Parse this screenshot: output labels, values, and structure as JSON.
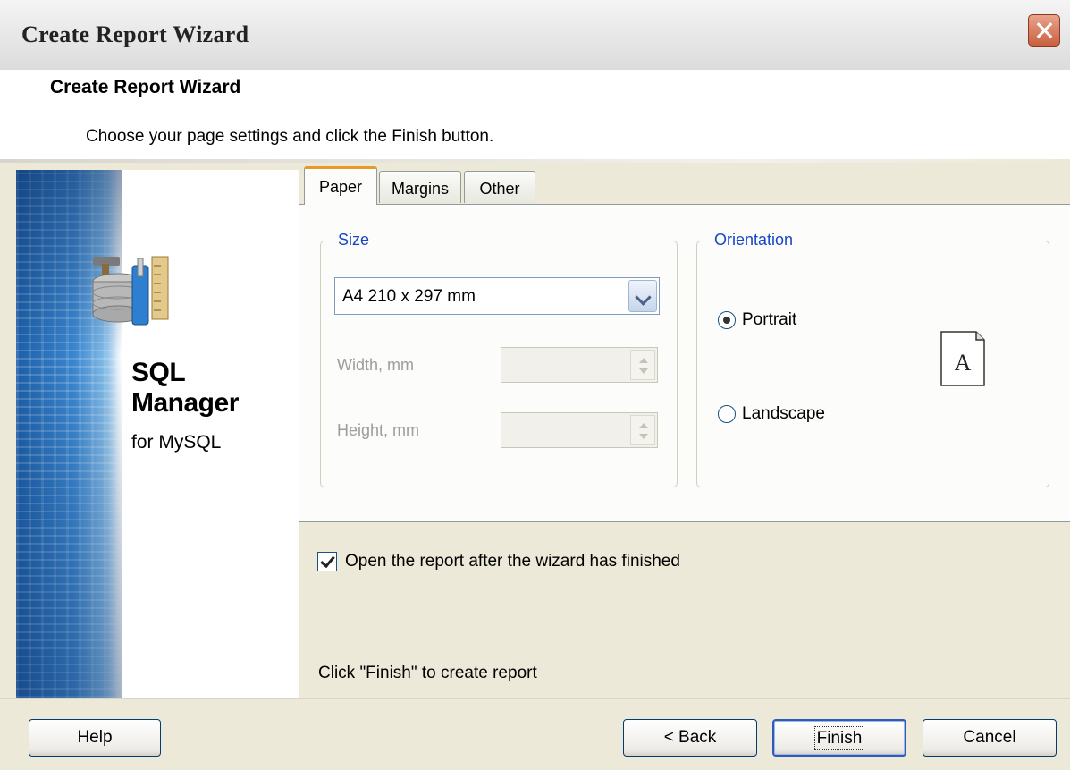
{
  "window": {
    "title": "Create Report Wizard"
  },
  "header": {
    "title": "Create Report Wizard",
    "subtitle": "Choose your page settings and click the Finish button."
  },
  "sidebar": {
    "brand_line1": "SQL",
    "brand_line2": "Manager",
    "brand_line3": "for MySQL",
    "logo_icon": "database-tools-icon"
  },
  "tabs": [
    {
      "label": "Paper",
      "active": true
    },
    {
      "label": "Margins",
      "active": false
    },
    {
      "label": "Other",
      "active": false
    }
  ],
  "size_group": {
    "label": "Size",
    "paper_select": {
      "value": "A4 210 x 297 mm"
    },
    "width_label": "Width, mm",
    "width_value": "",
    "height_label": "Height, mm",
    "height_value": ""
  },
  "orientation_group": {
    "label": "Orientation",
    "portrait_label": "Portrait",
    "landscape_label": "Landscape",
    "selected": "Portrait",
    "preview_letter": "A"
  },
  "options": {
    "open_report_label": "Open the report after the wizard has finished",
    "open_report_checked": true
  },
  "hint": "Click \"Finish\" to create report",
  "buttons": {
    "help": "Help",
    "back": "< Back",
    "finish": "Finish",
    "cancel": "Cancel"
  },
  "colors": {
    "group_label": "#1846c6",
    "active_tab_accent": "#e69a28",
    "sidebar_stripe": "#2b6fbd"
  }
}
